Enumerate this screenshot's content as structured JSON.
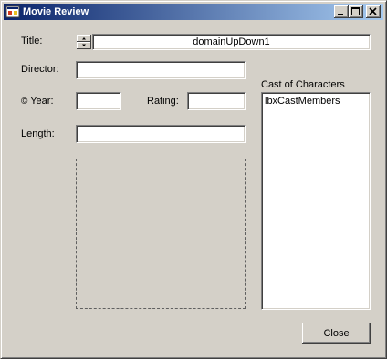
{
  "window": {
    "title": "Movie Review",
    "controls": {
      "minimize_icon": "minimize-icon",
      "maximize_icon": "maximize-icon",
      "close_icon": "close-icon"
    }
  },
  "form": {
    "title_label": "Title:",
    "title_value": "domainUpDown1",
    "director_label": "Director:",
    "director_value": "",
    "year_label": "Year:",
    "year_value": "",
    "rating_label": "Rating:",
    "rating_value": "",
    "length_label": "Length:",
    "length_value": ""
  },
  "cast": {
    "label": "Cast of Characters",
    "items": [
      "lbxCastMembers"
    ]
  },
  "buttons": {
    "close_label": "Close"
  },
  "colors": {
    "face": "#d4d0c8",
    "title_start": "#0a246a",
    "title_end": "#a6caf0"
  }
}
